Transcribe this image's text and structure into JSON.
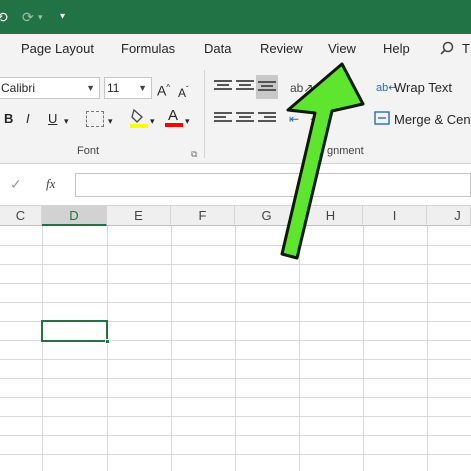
{
  "quick_access": {
    "undo_icon": "undo-icon",
    "redo_icon": "redo-icon",
    "customize_icon": "customize-qat-icon"
  },
  "tabs": [
    {
      "label": "Page Layout"
    },
    {
      "label": "Formulas"
    },
    {
      "label": "Data"
    },
    {
      "label": "Review"
    },
    {
      "label": "View"
    },
    {
      "label": "Help"
    }
  ],
  "search": {
    "icon": "search-icon",
    "partial_text": "T"
  },
  "font": {
    "name": "Calibri",
    "size": "11",
    "grow_label": "A",
    "shrink_label": "A",
    "bold": "B",
    "italic": "I",
    "underline": "U",
    "group_label": "Font"
  },
  "alignment": {
    "wrap_text": "Wrap Text",
    "merge_center": "Merge & Cente",
    "group_label": "gnment"
  },
  "formula_bar": {
    "cancel_icon": "✓",
    "fx_label": "fx",
    "value": ""
  },
  "grid": {
    "columns": [
      "C",
      "D",
      "E",
      "F",
      "G",
      "H",
      "I",
      "J"
    ],
    "selected_column": "D"
  },
  "colors": {
    "brand": "#217346",
    "highlight": "#ffff00",
    "font_color": "#ff0000",
    "arrow_fill": "#5ee62e",
    "arrow_stroke": "#0d1a06"
  }
}
